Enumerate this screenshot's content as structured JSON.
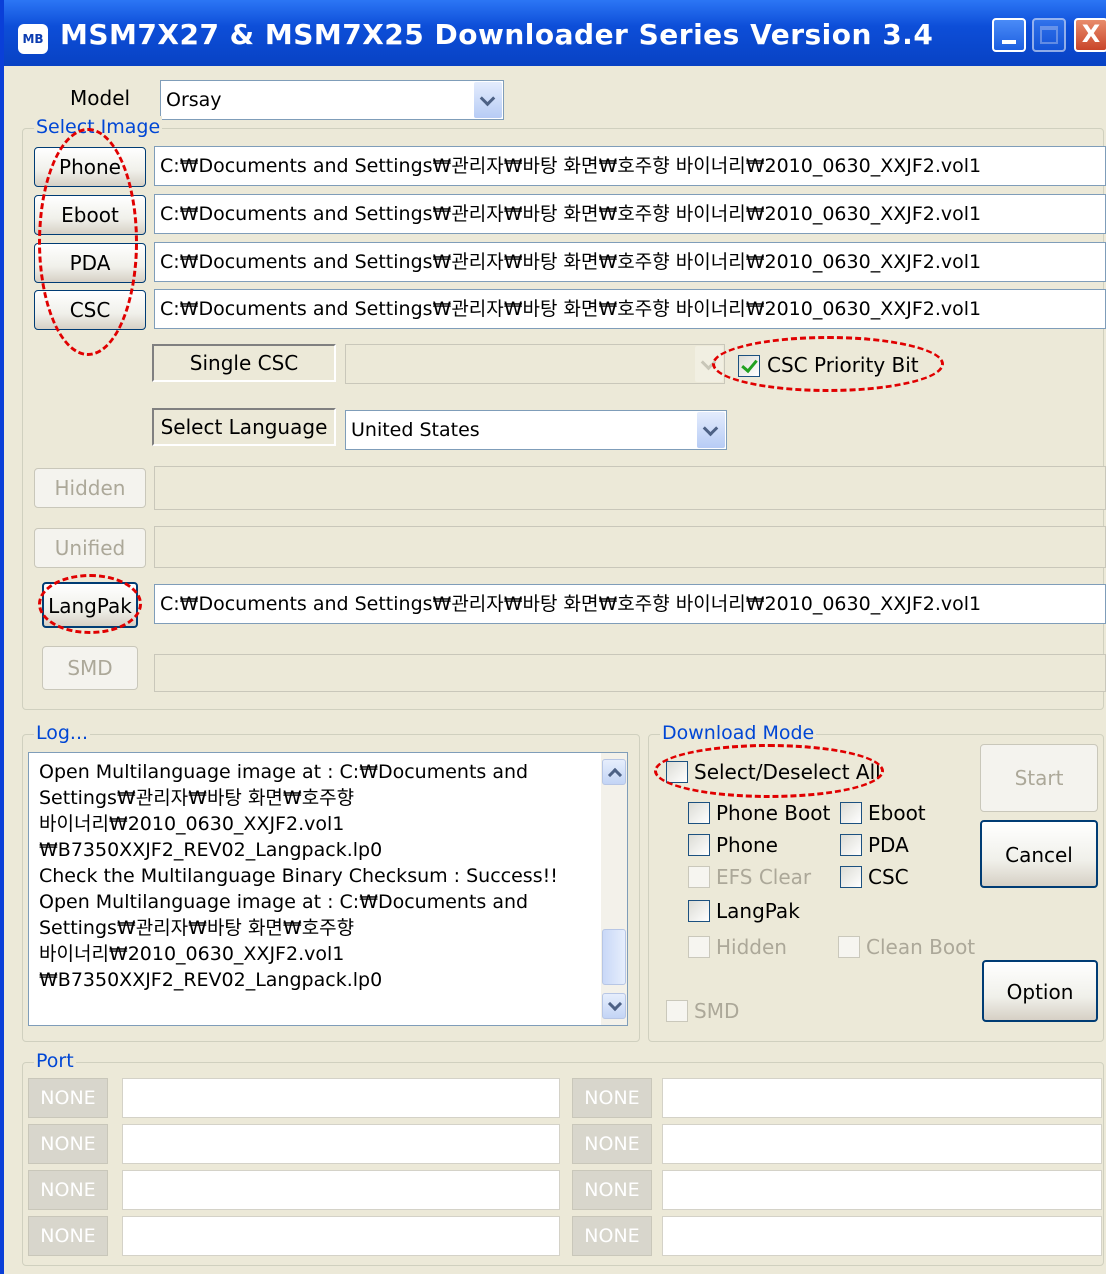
{
  "window": {
    "title": "MSM7X27 & MSM7X25 Downloader Series Version 3.4",
    "icon_label": "MB",
    "close_glyph": "X"
  },
  "model": {
    "label": "Model",
    "value": "Orsay"
  },
  "select_image": {
    "group_title": "Select Image",
    "phone": {
      "label": "Phone",
      "path": "C:₩Documents and Settings₩관리자₩바탕 화면₩호주향 바이너리₩2010_0630_XXJF2.vol1"
    },
    "eboot": {
      "label": "Eboot",
      "path": "C:₩Documents and Settings₩관리자₩바탕 화면₩호주향 바이너리₩2010_0630_XXJF2.vol1"
    },
    "pda": {
      "label": "PDA",
      "path": "C:₩Documents and Settings₩관리자₩바탕 화면₩호주향 바이너리₩2010_0630_XXJF2.vol1"
    },
    "csc": {
      "label": "CSC",
      "path": "C:₩Documents and Settings₩관리자₩바탕 화면₩호주향 바이너리₩2010_0630_XXJF2.vol1"
    },
    "single_csc_label": "Single CSC",
    "single_csc_value": "",
    "csc_priority_label": "CSC Priority Bit",
    "csc_priority_checked": true,
    "select_language_label": "Select Language",
    "language_value": "United States",
    "hidden": {
      "label": "Hidden",
      "path": ""
    },
    "unified": {
      "label": "Unified",
      "path": ""
    },
    "langpak": {
      "label": "LangPak",
      "path": "C:₩Documents and Settings₩관리자₩바탕 화면₩호주향 바이너리₩2010_0630_XXJF2.vol1"
    },
    "smd": {
      "label": "SMD",
      "path": ""
    }
  },
  "log": {
    "group_title": "Log...",
    "lines": [
      "Open Multilanguage  image at : C:₩Documents and",
      "Settings₩관리자₩바탕 화면₩호주향",
      "바이너리₩2010_0630_XXJF2.vol1",
      "₩B7350XXJF2_REV02_Langpack.lp0",
      "Check the Multilanguage Binary Checksum : Success!!",
      "Open Multilanguage  image at : C:₩Documents and",
      "Settings₩관리자₩바탕 화면₩호주향",
      "바이너리₩2010_0630_XXJF2.vol1",
      "₩B7350XXJF2_REV02_Langpack.lp0"
    ]
  },
  "download_mode": {
    "group_title": "Download Mode",
    "select_all": "Select/Deselect All",
    "phone_boot": "Phone Boot",
    "eboot": "Eboot",
    "phone": "Phone",
    "pda": "PDA",
    "efs_clear": "EFS Clear",
    "csc": "CSC",
    "langpak": "LangPak",
    "hidden": "Hidden",
    "clean_boot": "Clean Boot",
    "smd": "SMD"
  },
  "actions": {
    "start": "Start",
    "cancel": "Cancel",
    "option": "Option"
  },
  "port": {
    "group_title": "Port",
    "slots": [
      "NONE",
      "NONE",
      "NONE",
      "NONE",
      "NONE",
      "NONE",
      "NONE",
      "NONE"
    ]
  },
  "colors": {
    "titlebar": "#0d4ed8",
    "group_title": "#0046d5",
    "annotation": "#e00000",
    "window_bg": "#ece9d8"
  }
}
